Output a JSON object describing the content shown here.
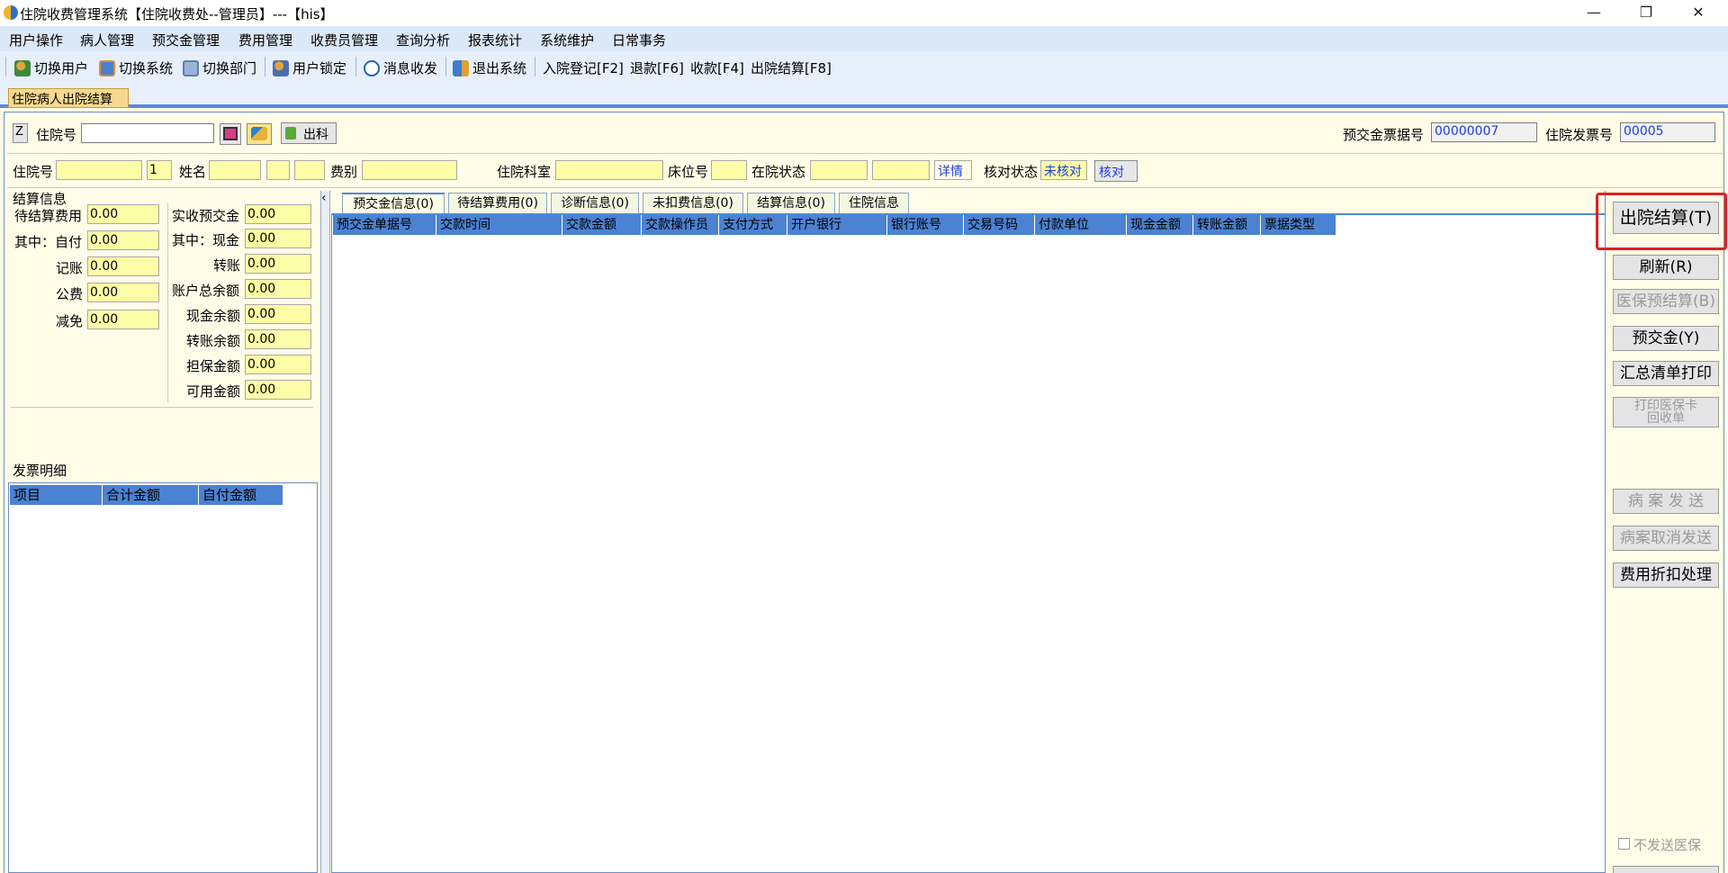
{
  "window": {
    "title": "住院收费管理系统【住院收费处--管理员】---【his】",
    "min": "—",
    "max": "❐",
    "close": "✕"
  },
  "menu": [
    "用户操作",
    "病人管理",
    "预交金管理",
    "费用管理",
    "收费员管理",
    "查询分析",
    "报表统计",
    "系统维护",
    "日常事务"
  ],
  "toolbar": {
    "switch_user": "切换用户",
    "switch_system": "切换系统",
    "switch_dept": "切换部门",
    "user_lock": "用户锁定",
    "message": "消息收发",
    "exit_system": "退出系统",
    "admission": "入院登记[F2]",
    "refund": "退款[F6]",
    "collect": "收款[F4]",
    "discharge": "出院结算[F8]"
  },
  "main_tab": "住院病人出院结算",
  "search": {
    "z_label": "Z",
    "inpatient_label": "住院号",
    "out_button": "出科",
    "deposit_receipt_label": "预交金票据号",
    "deposit_receipt_value": "00000007",
    "invoice_label": "住院发票号",
    "invoice_value": "00005"
  },
  "patient": {
    "inpatient_label": "住院号",
    "seq": "1",
    "name_label": "姓名",
    "fee_type_label": "费别",
    "dept_label": "住院科室",
    "bed_label": "床位号",
    "status_label": "在院状态",
    "detail_link": "详情",
    "check_status_label": "核对状态",
    "check_status_value": "未核对",
    "check_button": "核对"
  },
  "settlement": {
    "title": "结算信息",
    "left": [
      {
        "label": "待结算费用",
        "value": "0.00"
      },
      {
        "label": "其中：自付",
        "value": "0.00"
      },
      {
        "label": "记账",
        "value": "0.00"
      },
      {
        "label": "公费",
        "value": "0.00"
      },
      {
        "label": "减免",
        "value": "0.00"
      }
    ],
    "right": [
      {
        "label": "实收预交金",
        "value": "0.00"
      },
      {
        "label": "其中：现金",
        "value": "0.00"
      },
      {
        "label": "转账",
        "value": "0.00"
      },
      {
        "label": "账户总余额",
        "value": "0.00"
      },
      {
        "label": "现金余额",
        "value": "0.00"
      },
      {
        "label": "转账余额",
        "value": "0.00"
      },
      {
        "label": "担保金额",
        "value": "0.00"
      },
      {
        "label": "可用金额",
        "value": "0.00"
      }
    ]
  },
  "invoice_detail": {
    "title": "发票明细",
    "columns": [
      "项目",
      "合计金额",
      "自付金额"
    ]
  },
  "collapse_arrow": "‹",
  "panel_tabs": [
    "预交金信息(0)",
    "待结算费用(0)",
    "诊断信息(0)",
    "未扣费信息(0)",
    "结算信息(0)",
    "住院信息"
  ],
  "deposit_columns": [
    "预交金单据号",
    "交款时间",
    "交款金额",
    "交款操作员",
    "支付方式",
    "开户银行",
    "银行账号",
    "交易号码",
    "付款单位",
    "现金金额",
    "转账金额",
    "票据类型"
  ],
  "side_buttons": {
    "discharge": "出院结算(T)",
    "refresh": "刷新(R)",
    "ins_pre": "医保预结算(B)",
    "deposit": "预交金(Y)",
    "summary_print": "汇总清单打印",
    "print_card_1": "打印医保卡",
    "print_card_2": "回收单",
    "case_send": "病 案 发 送",
    "case_cancel": "病案取消发送",
    "discount": "费用折扣处理",
    "no_send_ins": "不发送医保"
  },
  "colors": {
    "accent": "#4b82d2",
    "highlight": "#e02020",
    "field": "#fdfda8"
  }
}
